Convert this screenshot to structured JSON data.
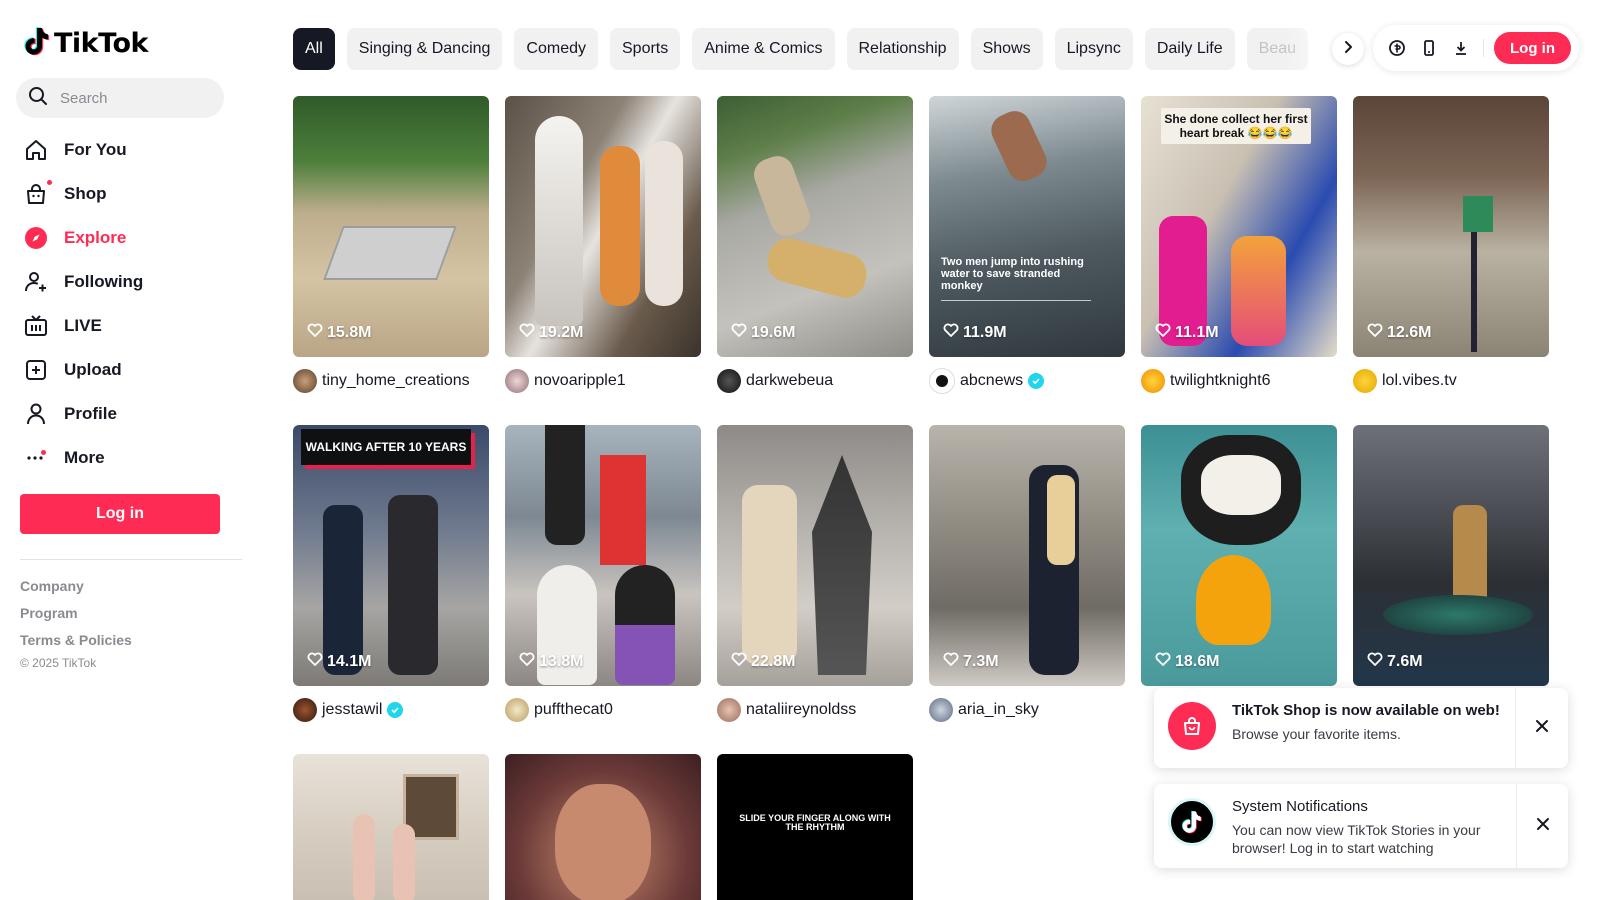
{
  "brand": {
    "name": "TikTok",
    "accent": "#fe2c55"
  },
  "search": {
    "placeholder": "Search"
  },
  "nav": [
    {
      "label": "For You",
      "icon": "home-icon"
    },
    {
      "label": "Shop",
      "icon": "shopping-bag-icon"
    },
    {
      "label": "Explore",
      "icon": "compass-icon",
      "active": true
    },
    {
      "label": "Following",
      "icon": "person-plus-icon"
    },
    {
      "label": "LIVE",
      "icon": "live-tv-icon"
    },
    {
      "label": "Upload",
      "icon": "plus-square-icon"
    },
    {
      "label": "Profile",
      "icon": "person-icon"
    },
    {
      "label": "More",
      "icon": "more-dots-icon"
    }
  ],
  "sidebar_login": "Log in",
  "footer": {
    "links": [
      "Company",
      "Program",
      "Terms & Policies"
    ],
    "copyright": "© 2025 TikTok"
  },
  "tabs": [
    "All",
    "Singing & Dancing",
    "Comedy",
    "Sports",
    "Anime & Comics",
    "Relationship",
    "Shows",
    "Lipsync",
    "Daily Life",
    "Beau"
  ],
  "header": {
    "login": "Log in",
    "icons": [
      "coin-icon",
      "phone-icon",
      "download-icon"
    ]
  },
  "videos": [
    {
      "likes": "15.8M",
      "user": "tiny_home_creations",
      "verified": false
    },
    {
      "likes": "19.2M",
      "user": "novoaripple1",
      "verified": false
    },
    {
      "likes": "19.6M",
      "user": "darkwebeua",
      "verified": false
    },
    {
      "likes": "11.9M",
      "user": "abcnews",
      "verified": true,
      "overlay": "Two men jump into rushing water to save stranded monkey"
    },
    {
      "likes": "11.1M",
      "user": "twilightknight6",
      "verified": false,
      "overlay": "She done collect her first heart break 😂😂😂"
    },
    {
      "likes": "12.6M",
      "user": "lol.vibes.tv",
      "verified": false
    },
    {
      "likes": "14.1M",
      "user": "jesstawil",
      "verified": true,
      "overlay": "WALKING AFTER 10 YEARS"
    },
    {
      "likes": "13.8M",
      "user": "puffthecat0",
      "verified": false
    },
    {
      "likes": "22.8M",
      "user": "nataliireynoldss",
      "verified": false
    },
    {
      "likes": "7.3M",
      "user": "aria_in_sky",
      "verified": false
    },
    {
      "likes": "18.6M",
      "user": "",
      "verified": false
    },
    {
      "likes": "7.6M",
      "user": "",
      "verified": false
    },
    {
      "likes": "",
      "user": "",
      "verified": false
    },
    {
      "likes": "",
      "user": "",
      "verified": false
    },
    {
      "likes": "",
      "user": "",
      "verified": false,
      "overlay": "SLIDE YOUR FINGER ALONG WITH THE RHYTHM"
    }
  ],
  "toasts": [
    {
      "title": "TikTok Shop is now available on web!",
      "message": "Browse your favorite items.",
      "icon": "shop-bag-icon"
    },
    {
      "title": "System Notifications",
      "message": "You can now view TikTok Stories in your browser! Log in to start watching",
      "icon": "tiktok-logo-icon"
    }
  ]
}
